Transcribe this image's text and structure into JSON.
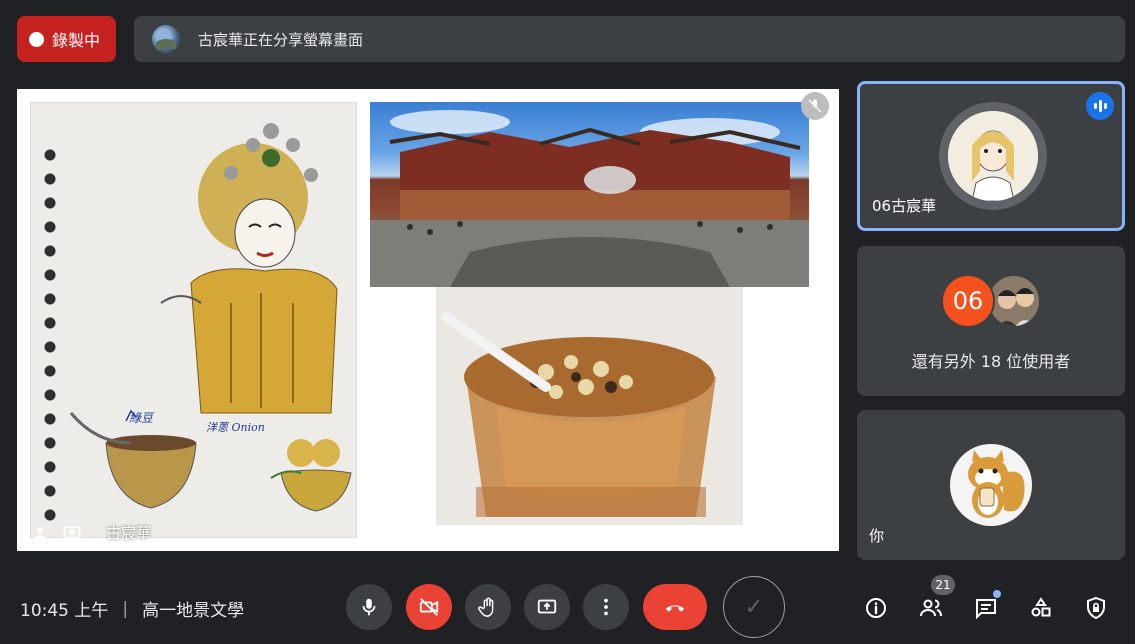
{
  "recording": {
    "label": "錄製中"
  },
  "share_banner": {
    "text": "古宸華正在分享螢幕畫面"
  },
  "presentation": {
    "handwriting_1": "綠豆",
    "handwriting_2": "洋蔥 Onion",
    "presenter_name": "古宸華"
  },
  "participants": [
    {
      "name": "06古宸華",
      "speaking": true
    },
    {
      "badge": "06",
      "others_text": "還有另外 18 位使用者"
    },
    {
      "name": "你"
    }
  ],
  "meeting": {
    "time": "10:45 上午",
    "separator": "|",
    "title": "高一地景文學"
  },
  "controls": {
    "mic": "mic-icon",
    "camera": "camera-off-icon",
    "raise_hand": "hand-icon",
    "present": "present-screen-icon",
    "more": "more-vert-icon",
    "hangup": "hangup-icon",
    "check": "✓"
  },
  "right_tools": {
    "people_count": "21",
    "icons": [
      "info-icon",
      "people-icon",
      "chat-icon",
      "activities-icon",
      "host-controls-icon"
    ]
  },
  "colors": {
    "accent": "#8ab4f8",
    "danger": "#ea4335",
    "recording": "#c5221f",
    "badge": "#f4511e",
    "background": "#202124",
    "surface": "#3c4043"
  }
}
